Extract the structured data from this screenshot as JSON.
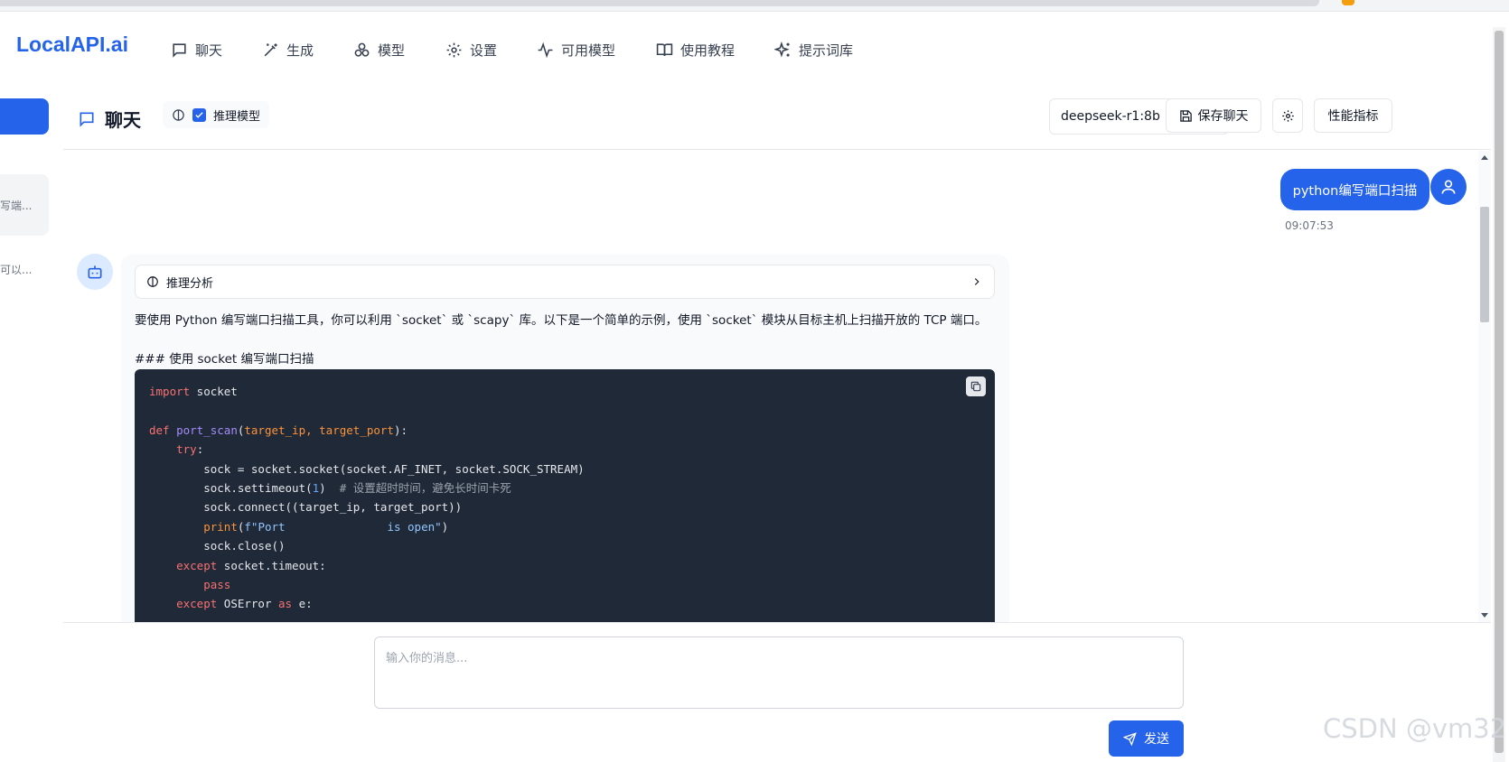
{
  "brand": {
    "logo": "LocalAPI.ai",
    "accent": "#2563eb"
  },
  "nav": [
    {
      "label": "聊天",
      "icon": "chat-icon"
    },
    {
      "label": "生成",
      "icon": "magic-wand-icon"
    },
    {
      "label": "模型",
      "icon": "boxes-icon"
    },
    {
      "label": "设置",
      "icon": "gear-icon"
    },
    {
      "label": "可用模型",
      "icon": "activity-icon"
    },
    {
      "label": "使用教程",
      "icon": "book-icon"
    },
    {
      "label": "提示词库",
      "icon": "sparkles-icon"
    }
  ],
  "sidebar": {
    "items": [
      "写端...",
      "可以..."
    ]
  },
  "chat_header": {
    "title": "聊天",
    "reasoning_label": "推理模型",
    "reasoning_checked": true,
    "model": "deepseek-r1:8b",
    "save_label": "保存聊天",
    "metrics_label": "性能指标"
  },
  "messages": {
    "user": {
      "text": "python编写端口扫描",
      "time": "09:07:53"
    },
    "assistant": {
      "reasoning_title": "推理分析",
      "intro": "要使用 Python 编写端口扫描工具，你可以利用 `socket` 或 `scapy` 库。以下是一个简单的示例，使用 `socket` 模块从目标主机上扫描开放的 TCP 端口。",
      "heading": "### 使用 socket 编写端口扫描",
      "code": {
        "line1_kw": "import",
        "line1_rest": " socket",
        "def_kw": "def",
        "fn_name": "port_scan",
        "params": "target_ip, target_port",
        "try_kw": "try",
        "sock_create": "sock = socket.socket(socket.AF_INET, socket.SOCK_STREAM)",
        "settimeout": "sock.settimeout(",
        "timeout_val": "1",
        "comment": "# 设置超时时间，避免长时间卡死",
        "connect": "sock.connect((target_ip, target_port))",
        "print_fn": "print",
        "fstring_start": "f\"Port",
        "fstring_end": "is open\"",
        "close": "sock.close()",
        "except_kw": "except",
        "timeout_exc": "socket.timeout:",
        "pass_kw": "pass",
        "oserror": "OSError",
        "as_kw": "as",
        "e_var": "e:"
      }
    }
  },
  "input": {
    "placeholder": "输入你的消息...",
    "send_label": "发送"
  },
  "watermark": "CSDN @vm32"
}
